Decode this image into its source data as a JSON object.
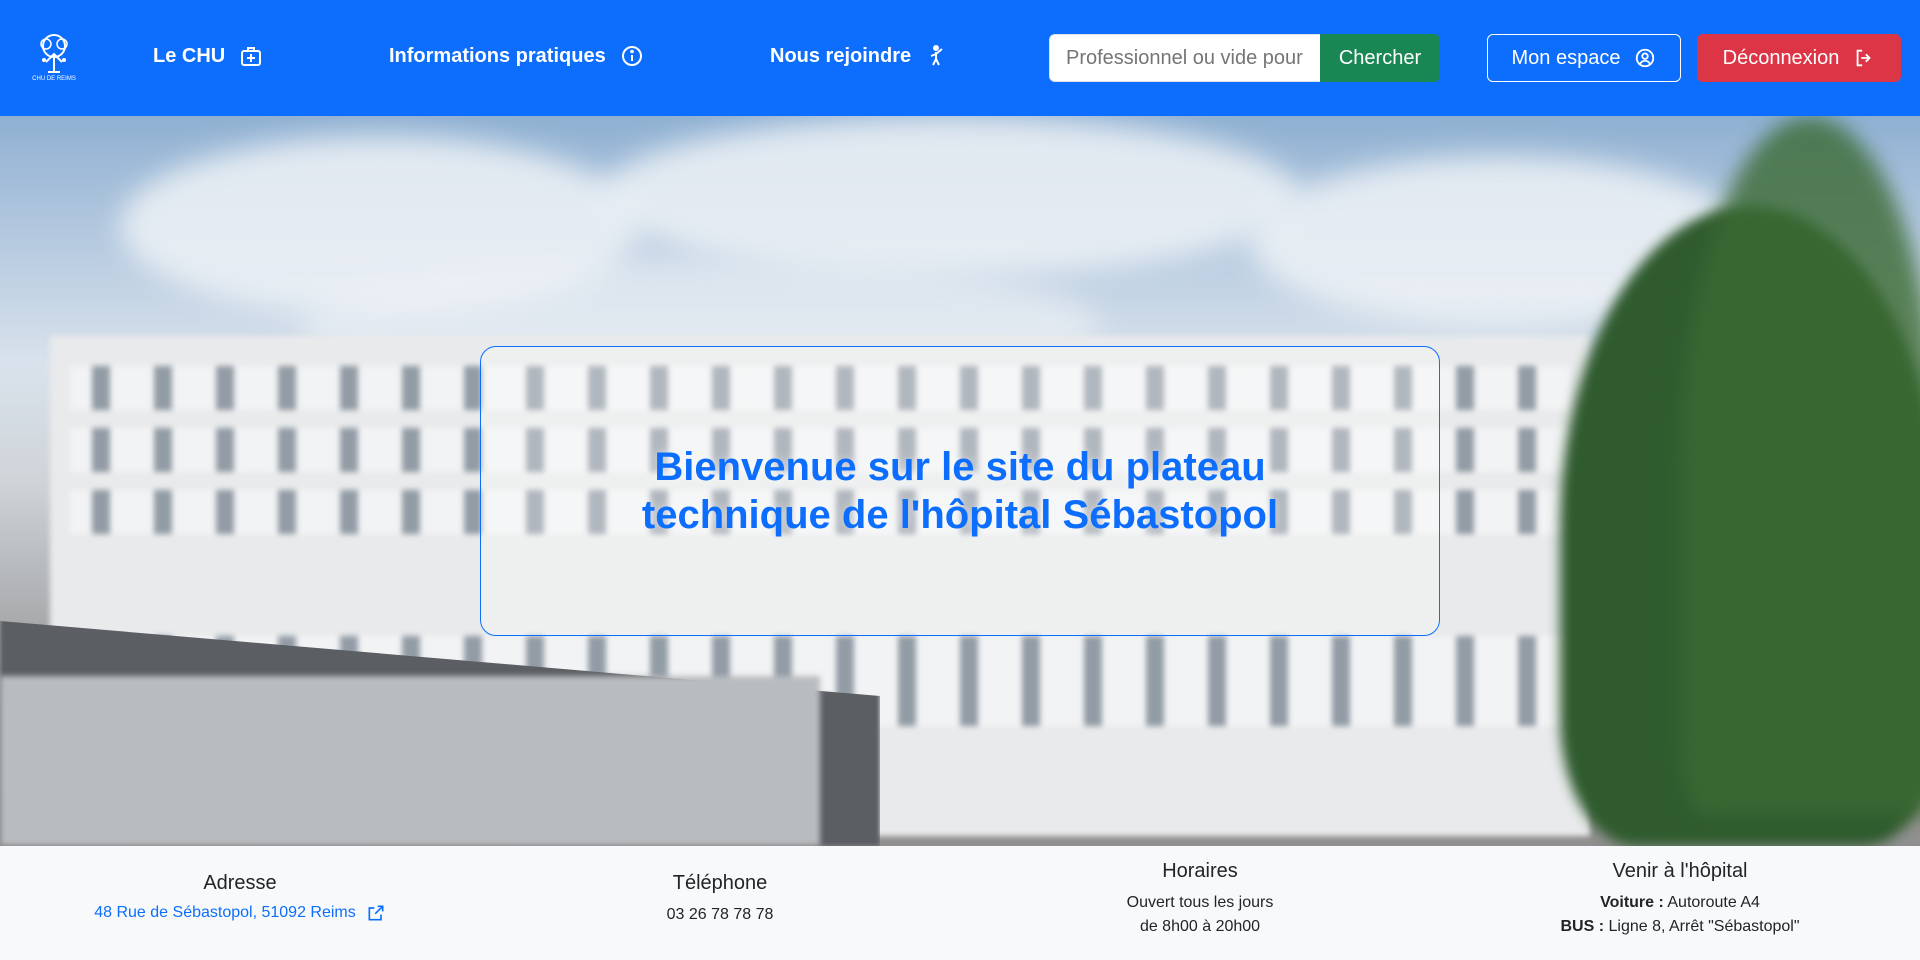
{
  "brand": {
    "logo_text": "CHU DE REIMS"
  },
  "nav": {
    "chu_label": "Le CHU",
    "info_label": "Informations pratiques",
    "join_label": "Nous rejoindre"
  },
  "search": {
    "placeholder": "Professionnel ou vide pour tout",
    "button_label": "Chercher"
  },
  "account": {
    "space_label": "Mon espace",
    "logout_label": "Déconnexion"
  },
  "hero": {
    "title": "Bienvenue sur le site du plateau technique de l'hôpital Sébastopol"
  },
  "footer": {
    "address": {
      "title": "Adresse",
      "value": "48 Rue de Sébastopol, 51092 Reims"
    },
    "phone": {
      "title": "Téléphone",
      "value": "03 26 78 78 78"
    },
    "hours": {
      "title": "Horaires",
      "line1": "Ouvert tous les jours",
      "line2": "de 8h00 à 20h00"
    },
    "access": {
      "title": "Venir à l'hôpital",
      "car_label": "Voiture :",
      "car_value": "Autoroute A4",
      "bus_label": "BUS :",
      "bus_value": "Ligne 8, Arrêt \"Sébastopol\""
    }
  },
  "colors": {
    "primary": "#0d6efd",
    "success": "#198754",
    "danger": "#dc3545",
    "footer_bg": "#f8f9fa"
  }
}
